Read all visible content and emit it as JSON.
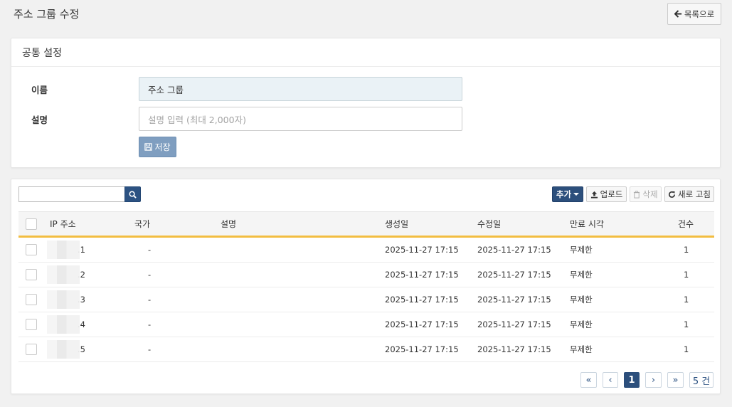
{
  "page": {
    "title": "주소 그룹 수정",
    "back_label": "목록으로"
  },
  "common": {
    "header": "공통 설정",
    "name_label": "이름",
    "name_value": "주소 그룹",
    "desc_label": "설명",
    "desc_placeholder": "설명 입력 (최대 2,000자)",
    "save_label": "저장"
  },
  "toolbar": {
    "add_label": "추가",
    "upload_label": "업로드",
    "delete_label": "삭제",
    "refresh_label": "새로 고침"
  },
  "table": {
    "headers": {
      "ip": "IP 주소",
      "country": "국가",
      "desc": "설명",
      "created": "생성일",
      "modified": "수정일",
      "expiry": "만료 시각",
      "count": "건수"
    },
    "rows": [
      {
        "ip_suffix": ".1",
        "country": "-",
        "desc": "",
        "created": "2025-11-27 17:15",
        "modified": "2025-11-27 17:15",
        "expiry": "무제한",
        "count": "1"
      },
      {
        "ip_suffix": ".2",
        "country": "-",
        "desc": "",
        "created": "2025-11-27 17:15",
        "modified": "2025-11-27 17:15",
        "expiry": "무제한",
        "count": "1"
      },
      {
        "ip_suffix": ".3",
        "country": "-",
        "desc": "",
        "created": "2025-11-27 17:15",
        "modified": "2025-11-27 17:15",
        "expiry": "무제한",
        "count": "1"
      },
      {
        "ip_suffix": ".4",
        "country": "-",
        "desc": "",
        "created": "2025-11-27 17:15",
        "modified": "2025-11-27 17:15",
        "expiry": "무제한",
        "count": "1"
      },
      {
        "ip_suffix": ".5",
        "country": "-",
        "desc": "",
        "created": "2025-11-27 17:15",
        "modified": "2025-11-27 17:15",
        "expiry": "무제한",
        "count": "1"
      }
    ]
  },
  "pagination": {
    "first": "«",
    "prev": "‹",
    "current": "1",
    "next": "›",
    "last": "»",
    "total": "5 건"
  },
  "colors": {
    "accent": "#2c4f7c",
    "header_underline": "#f2bd41",
    "save": "#7f9ec0"
  },
  "icons": {
    "back": "arrow-left-icon",
    "save": "floppy-icon",
    "search": "search-icon",
    "add": "caret-down-icon",
    "upload": "upload-icon",
    "delete": "trash-icon",
    "refresh": "refresh-icon"
  }
}
